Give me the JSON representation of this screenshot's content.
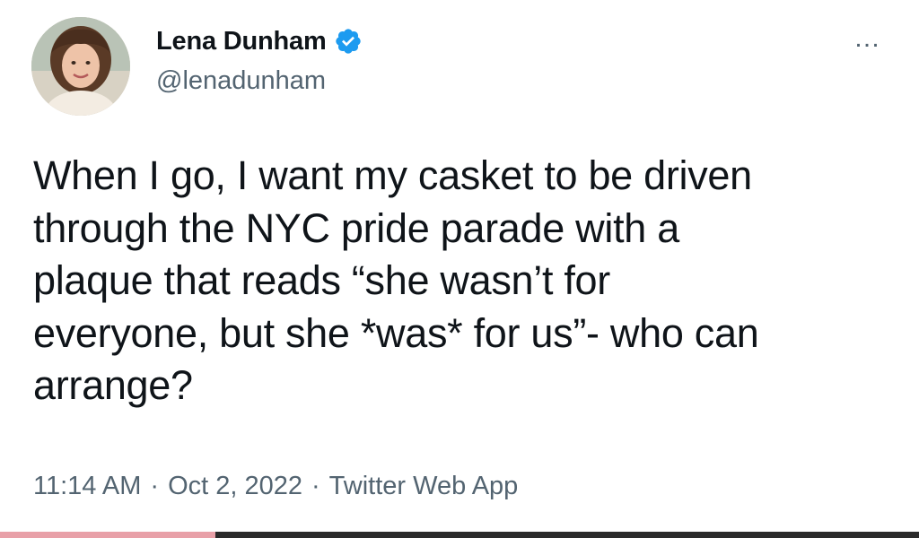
{
  "tweet": {
    "author": {
      "display_name": "Lena Dunham",
      "handle": "@lenadunham",
      "verified": true
    },
    "more_icon": "…",
    "text": "When I go, I want my casket to be driven\nthrough the NYC pride parade with a\nplaque that reads “she wasn’t for\neveryone, but she *was* for us”- who can\narrange?",
    "timestamp": {
      "time": "11:14 AM",
      "date": "Oct 2, 2022",
      "source": "Twitter Web App",
      "separator": "·"
    }
  },
  "colors": {
    "verified": "#1d9bf0",
    "secondary_text": "#536471",
    "primary_text": "#0f1419"
  }
}
